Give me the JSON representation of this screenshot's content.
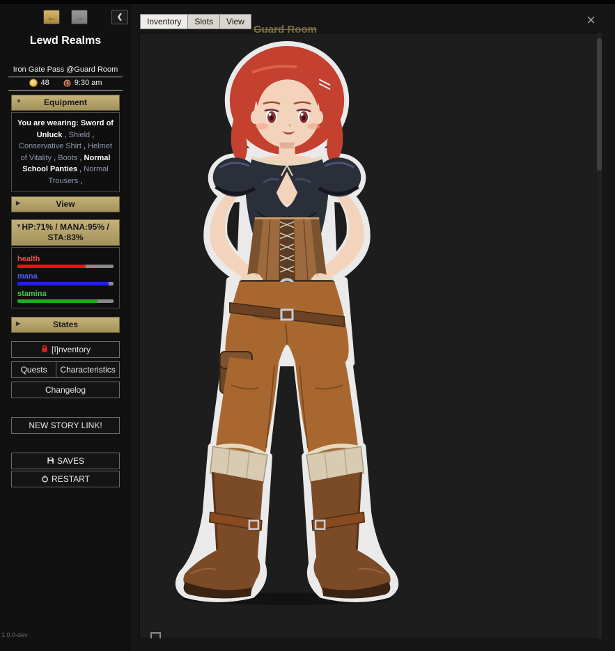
{
  "app": {
    "title": "Lewd Realms",
    "version": "1.0.0-dev"
  },
  "colors": {
    "panel_header": "#b3a264",
    "link": "#8e97b3",
    "health": "#ff2020",
    "mana": "#2222ee",
    "stamina": "#22aa22"
  },
  "icons": {
    "caret_open": "▼",
    "caret_closed": "▶",
    "back": "arrow-left-icon",
    "forward": "arrow-right-icon",
    "collapse": "chevron-left-icon",
    "gold": "coin-icon",
    "time": "clock-icon",
    "inventory": "backpack-icon",
    "saves": "floppy-icon",
    "restart": "power-icon",
    "close": "close-icon",
    "footer": "checkbox-icon",
    "portrait": "character-portrait"
  },
  "nav": {
    "back_glyph": "←",
    "forward_glyph": "→",
    "collapse_glyph": "❮"
  },
  "status": {
    "location": "Iron Gate Pass @Guard Room",
    "gold": "48",
    "time": "9:30 am"
  },
  "equipment": {
    "header": "Equipment",
    "prefix": "You are wearing:",
    "separator": " , ",
    "items": [
      {
        "label": "Sword of Unluck",
        "style": "bold"
      },
      {
        "label": "Shield",
        "style": "link"
      },
      {
        "label": "Conservative Shirt",
        "style": "link"
      },
      {
        "label": "Helmet of Vitality",
        "style": "link"
      },
      {
        "label": "Boots",
        "style": "link"
      },
      {
        "label": "Normal School Panties",
        "style": "bold"
      },
      {
        "label": "Normal Trousers",
        "style": "link"
      }
    ]
  },
  "view_panel": {
    "header": "View"
  },
  "stats": {
    "header": "HP:71% / MANA:95% / STA:83%",
    "bars": [
      {
        "label": "health",
        "value": 71,
        "fill": "#ee1111",
        "track": "#8a8a8a",
        "label_color": "#ff4444"
      },
      {
        "label": "mana",
        "value": 95,
        "fill": "#2222dd",
        "track": "#8a8a8a",
        "label_color": "#4d5dff"
      },
      {
        "label": "stamina",
        "value": 83,
        "fill": "#22aa22",
        "track": "#8a8a8a",
        "label_color": "#44cc44"
      }
    ]
  },
  "states_panel": {
    "header": "States"
  },
  "actions": {
    "inventory": "[I]nventory",
    "quests": "Quests",
    "characteristics": "Characteristics",
    "changelog": "Changelog",
    "story_link": "NEW STORY LINK!",
    "saves": "SAVES",
    "restart": "RESTART"
  },
  "modal": {
    "tabs": [
      {
        "label": "Inventory",
        "active": true
      },
      {
        "label": "Slots",
        "active": false
      },
      {
        "label": "View",
        "active": false
      }
    ],
    "close_glyph": "×"
  },
  "background_page": {
    "room_title": "Guard Room"
  }
}
